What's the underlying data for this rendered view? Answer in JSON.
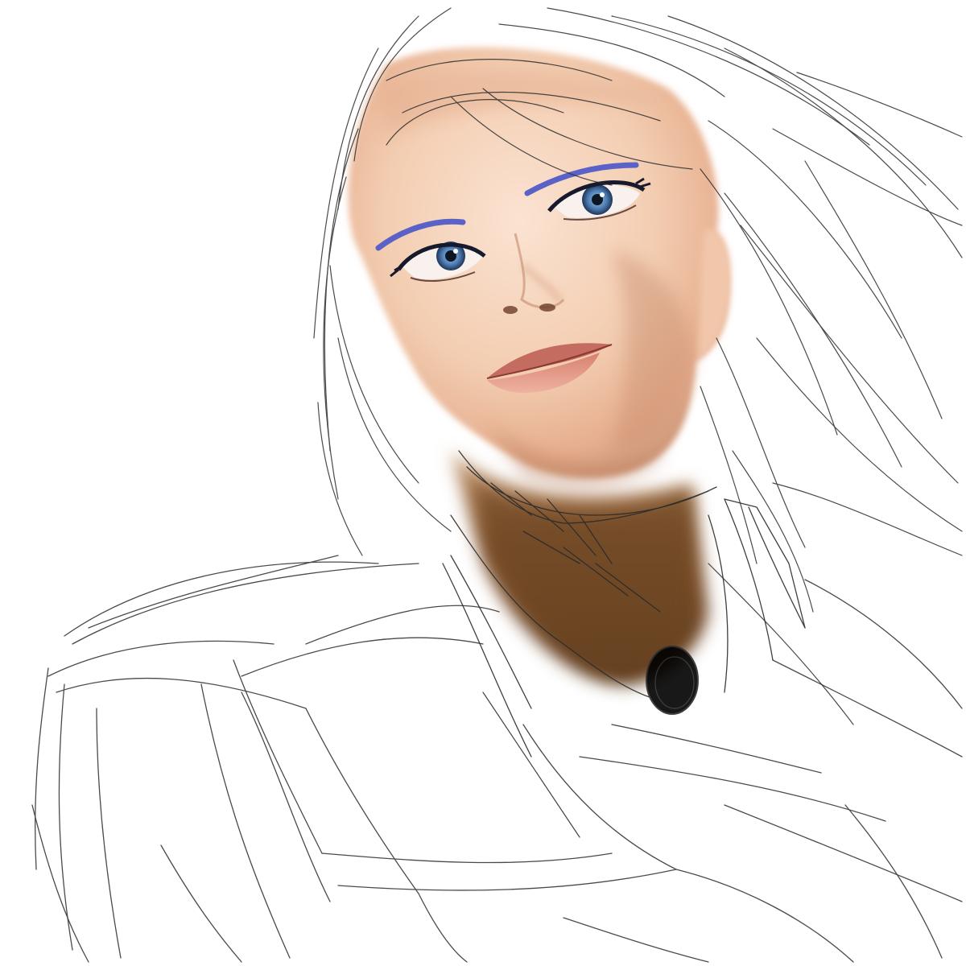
{
  "artwork": {
    "kind": "digital sketch portrait, partially painted",
    "colors": {
      "background": "#ffffff",
      "pencil_line": "#2b2b2b",
      "skin_light": "#f6d6bf",
      "skin_mid": "#e9b89a",
      "skin_shadow": "#c98f6f",
      "neck_shadow": "#7a4e2a",
      "iris": "#4f7fb5",
      "pupil": "#0d1722",
      "eyeliner": "#17192c",
      "brow_stroke": "#5a62c8",
      "lips": "#e08f80",
      "lips_shadow": "#c56c60",
      "nostril": "#6b3c28"
    },
    "icons": [
      "face-paint",
      "hair-sketch",
      "collar-sketch",
      "armor-sketch"
    ]
  }
}
